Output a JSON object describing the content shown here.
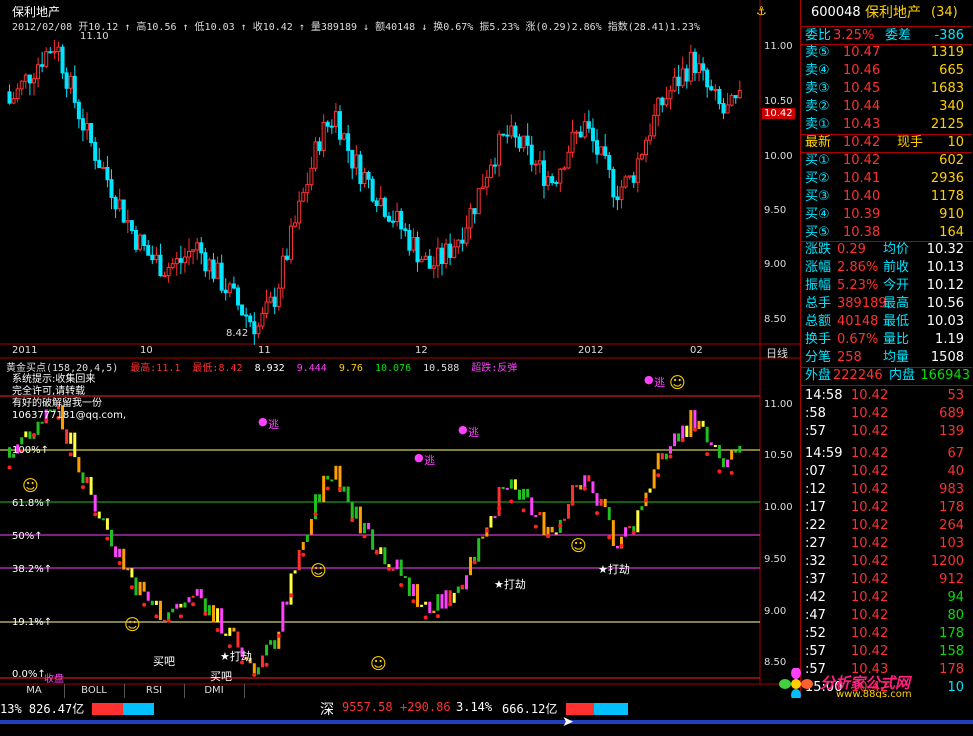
{
  "chart_header": {
    "title": "保利地产",
    "info": "2012/02/08 开10.12 ↑ 高10.56 ↑ 低10.03 ↑ 收10.42 ↑ 量389189 ↓ 额40148 ↓ 换0.67% 振5.23% 涨(0.29)2.86% 指数(28.41)1.23%",
    "high_label": "11.10",
    "low_label": "8.42",
    "cur_label": "10.42"
  },
  "price_axis": [
    "11.00",
    "10.50",
    "10.00",
    "9.50",
    "9.00",
    "8.50"
  ],
  "time_axis": [
    "2011",
    "10",
    "11",
    "12",
    "2012",
    "02"
  ],
  "period": "日线",
  "indicator": {
    "name": "黄金买点",
    "params": "(158,20,4,5)",
    "high": "最高:11.1",
    "low": "最低:8.42",
    "v1": "8.932",
    "v2": "9.444",
    "v3": "9.76",
    "v4": "10.076",
    "v5": "10.588",
    "signal": "超跌:反弹",
    "notice1": "系统提示:收集回来",
    "notice2": "完全许可,请转载",
    "notice3": "有好的破解留我一份",
    "notice4": "1063777181@qq.com,",
    "levels": [
      "61.8%↑",
      "50%↑",
      "38.2%↑",
      "19.1%↑",
      "100%↑",
      "0.0%↑"
    ],
    "axis": [
      "11.00",
      "10.50",
      "10.00",
      "9.50",
      "9.00",
      "8.50"
    ],
    "marks": {
      "escape": "逃",
      "rob": "★打劫",
      "buy": "买吧",
      "shou": "收盘"
    }
  },
  "tabs": [
    "MA",
    "BOLL",
    "RSI",
    "DMI"
  ],
  "quote": {
    "code": "600048",
    "name": "保利地产",
    "count": "(34)",
    "webi_label": "委比",
    "webi": "3.25%",
    "weicha_label": "委差",
    "weicha": "-386",
    "asks": [
      {
        "label": "卖⑤",
        "price": "10.47",
        "vol": "1319"
      },
      {
        "label": "卖④",
        "price": "10.46",
        "vol": "665"
      },
      {
        "label": "卖③",
        "price": "10.45",
        "vol": "1683"
      },
      {
        "label": "卖②",
        "price": "10.44",
        "vol": "340"
      },
      {
        "label": "卖①",
        "price": "10.43",
        "vol": "2125"
      }
    ],
    "latest_label": "最新",
    "latest": "10.42",
    "xianshou_label": "现手",
    "xianshou": "10",
    "bids": [
      {
        "label": "买①",
        "price": "10.42",
        "vol": "602"
      },
      {
        "label": "买②",
        "price": "10.41",
        "vol": "2936"
      },
      {
        "label": "买③",
        "price": "10.40",
        "vol": "1178"
      },
      {
        "label": "买④",
        "price": "10.39",
        "vol": "910"
      },
      {
        "label": "买⑤",
        "price": "10.38",
        "vol": "164"
      }
    ],
    "stats": [
      {
        "l1": "涨跌",
        "v1": "0.29",
        "l2": "均价",
        "v2": "10.32"
      },
      {
        "l1": "涨幅",
        "v1": "2.86%",
        "l2": "前收",
        "v2": "10.13"
      },
      {
        "l1": "振幅",
        "v1": "5.23%",
        "l2": "今开",
        "v2": "10.12"
      },
      {
        "l1": "总手",
        "v1": "389189",
        "l2": "最高",
        "v2": "10.56"
      },
      {
        "l1": "总额",
        "v1": "40148",
        "l2": "最低",
        "v2": "10.03"
      },
      {
        "l1": "换手",
        "v1": "0.67%",
        "l2": "量比",
        "v2": "1.19"
      },
      {
        "l1": "分笔",
        "v1": "258",
        "l2": "均量",
        "v2": "1508"
      }
    ],
    "wai_label": "外盘",
    "wai": "222246",
    "nei_label": "内盘",
    "nei": "166943",
    "ticks": [
      {
        "t": "14:58",
        "p": "10.42",
        "v": "53",
        "c": "red"
      },
      {
        "t": ":58",
        "p": "10.42",
        "v": "689",
        "c": "red"
      },
      {
        "t": ":57",
        "p": "10.42",
        "v": "139",
        "c": "red"
      },
      {
        "t": "14:59",
        "p": "10.42",
        "v": "67",
        "c": "red"
      },
      {
        "t": ":07",
        "p": "10.42",
        "v": "40",
        "c": "red"
      },
      {
        "t": ":12",
        "p": "10.42",
        "v": "983",
        "c": "red"
      },
      {
        "t": ":17",
        "p": "10.42",
        "v": "178",
        "c": "red"
      },
      {
        "t": ":22",
        "p": "10.42",
        "v": "264",
        "c": "red"
      },
      {
        "t": ":27",
        "p": "10.42",
        "v": "103",
        "c": "red"
      },
      {
        "t": ":32",
        "p": "10.42",
        "v": "1200",
        "c": "red"
      },
      {
        "t": ":37",
        "p": "10.42",
        "v": "912",
        "c": "red"
      },
      {
        "t": ":42",
        "p": "10.42",
        "v": "94",
        "c": "grn"
      },
      {
        "t": ":47",
        "p": "10.42",
        "v": "80",
        "c": "grn"
      },
      {
        "t": ":52",
        "p": "10.42",
        "v": "178",
        "c": "grn"
      },
      {
        "t": ":57",
        "p": "10.42",
        "v": "158",
        "c": "grn"
      },
      {
        "t": ":57",
        "p": "10.43",
        "v": "178",
        "c": "red"
      },
      {
        "t": "15:00",
        "p": "10.42",
        "v": "10",
        "c": "cy"
      }
    ]
  },
  "status": {
    "left": "13% 826.47亿",
    "shen_label": "深",
    "shen_val": "9557.58",
    "shen_chg": "+290.86",
    "shen_pct": "3.14%",
    "shen_amt": "666.12亿"
  },
  "logo": {
    "text": "分析家公式网",
    "url": "www.88gs.com"
  },
  "colors": {
    "up": "#ff3030",
    "down": "#00e5ff",
    "grid": "#a00000",
    "accent": "#ffd000"
  }
}
